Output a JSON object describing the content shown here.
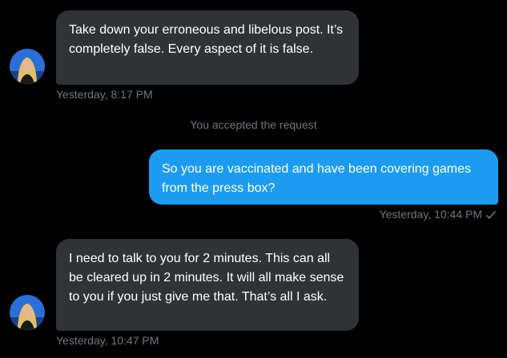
{
  "conversation": {
    "messages": [
      {
        "direction": "incoming",
        "text": "Take down your erroneous and libelous post. It’s completely false. Every aspect of it is false.",
        "timestamp": "Yesterday, 8:17 PM"
      },
      {
        "direction": "system",
        "text": "You accepted the request"
      },
      {
        "direction": "outgoing",
        "text": "So you are vaccinated and have been covering games from the press box?",
        "timestamp": "Yesterday, 10:44 PM",
        "status_icon": "checkmark-icon"
      },
      {
        "direction": "incoming",
        "text": "I need to talk to you for 2 minutes. This can all be cleared up in 2 minutes. It will all make sense to you if you just give me that. That’s all I ask.",
        "timestamp": "Yesterday, 10:47 PM"
      }
    ]
  },
  "colors": {
    "background": "#000000",
    "incoming_bubble": "#2f3336",
    "outgoing_bubble": "#1d9bf0",
    "meta_text": "#71767b"
  }
}
